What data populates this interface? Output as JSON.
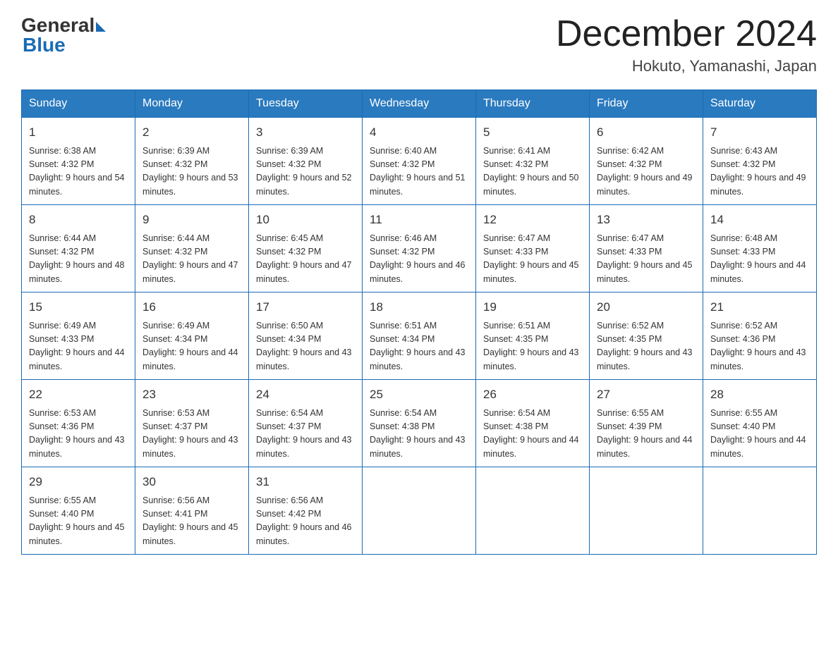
{
  "header": {
    "logo_general": "General",
    "logo_blue": "Blue",
    "month_title": "December 2024",
    "subtitle": "Hokuto, Yamanashi, Japan"
  },
  "weekdays": [
    "Sunday",
    "Monday",
    "Tuesday",
    "Wednesday",
    "Thursday",
    "Friday",
    "Saturday"
  ],
  "weeks": [
    [
      {
        "day": "1",
        "sunrise": "6:38 AM",
        "sunset": "4:32 PM",
        "daylight": "9 hours and 54 minutes."
      },
      {
        "day": "2",
        "sunrise": "6:39 AM",
        "sunset": "4:32 PM",
        "daylight": "9 hours and 53 minutes."
      },
      {
        "day": "3",
        "sunrise": "6:39 AM",
        "sunset": "4:32 PM",
        "daylight": "9 hours and 52 minutes."
      },
      {
        "day": "4",
        "sunrise": "6:40 AM",
        "sunset": "4:32 PM",
        "daylight": "9 hours and 51 minutes."
      },
      {
        "day": "5",
        "sunrise": "6:41 AM",
        "sunset": "4:32 PM",
        "daylight": "9 hours and 50 minutes."
      },
      {
        "day": "6",
        "sunrise": "6:42 AM",
        "sunset": "4:32 PM",
        "daylight": "9 hours and 49 minutes."
      },
      {
        "day": "7",
        "sunrise": "6:43 AM",
        "sunset": "4:32 PM",
        "daylight": "9 hours and 49 minutes."
      }
    ],
    [
      {
        "day": "8",
        "sunrise": "6:44 AM",
        "sunset": "4:32 PM",
        "daylight": "9 hours and 48 minutes."
      },
      {
        "day": "9",
        "sunrise": "6:44 AM",
        "sunset": "4:32 PM",
        "daylight": "9 hours and 47 minutes."
      },
      {
        "day": "10",
        "sunrise": "6:45 AM",
        "sunset": "4:32 PM",
        "daylight": "9 hours and 47 minutes."
      },
      {
        "day": "11",
        "sunrise": "6:46 AM",
        "sunset": "4:32 PM",
        "daylight": "9 hours and 46 minutes."
      },
      {
        "day": "12",
        "sunrise": "6:47 AM",
        "sunset": "4:33 PM",
        "daylight": "9 hours and 45 minutes."
      },
      {
        "day": "13",
        "sunrise": "6:47 AM",
        "sunset": "4:33 PM",
        "daylight": "9 hours and 45 minutes."
      },
      {
        "day": "14",
        "sunrise": "6:48 AM",
        "sunset": "4:33 PM",
        "daylight": "9 hours and 44 minutes."
      }
    ],
    [
      {
        "day": "15",
        "sunrise": "6:49 AM",
        "sunset": "4:33 PM",
        "daylight": "9 hours and 44 minutes."
      },
      {
        "day": "16",
        "sunrise": "6:49 AM",
        "sunset": "4:34 PM",
        "daylight": "9 hours and 44 minutes."
      },
      {
        "day": "17",
        "sunrise": "6:50 AM",
        "sunset": "4:34 PM",
        "daylight": "9 hours and 43 minutes."
      },
      {
        "day": "18",
        "sunrise": "6:51 AM",
        "sunset": "4:34 PM",
        "daylight": "9 hours and 43 minutes."
      },
      {
        "day": "19",
        "sunrise": "6:51 AM",
        "sunset": "4:35 PM",
        "daylight": "9 hours and 43 minutes."
      },
      {
        "day": "20",
        "sunrise": "6:52 AM",
        "sunset": "4:35 PM",
        "daylight": "9 hours and 43 minutes."
      },
      {
        "day": "21",
        "sunrise": "6:52 AM",
        "sunset": "4:36 PM",
        "daylight": "9 hours and 43 minutes."
      }
    ],
    [
      {
        "day": "22",
        "sunrise": "6:53 AM",
        "sunset": "4:36 PM",
        "daylight": "9 hours and 43 minutes."
      },
      {
        "day": "23",
        "sunrise": "6:53 AM",
        "sunset": "4:37 PM",
        "daylight": "9 hours and 43 minutes."
      },
      {
        "day": "24",
        "sunrise": "6:54 AM",
        "sunset": "4:37 PM",
        "daylight": "9 hours and 43 minutes."
      },
      {
        "day": "25",
        "sunrise": "6:54 AM",
        "sunset": "4:38 PM",
        "daylight": "9 hours and 43 minutes."
      },
      {
        "day": "26",
        "sunrise": "6:54 AM",
        "sunset": "4:38 PM",
        "daylight": "9 hours and 44 minutes."
      },
      {
        "day": "27",
        "sunrise": "6:55 AM",
        "sunset": "4:39 PM",
        "daylight": "9 hours and 44 minutes."
      },
      {
        "day": "28",
        "sunrise": "6:55 AM",
        "sunset": "4:40 PM",
        "daylight": "9 hours and 44 minutes."
      }
    ],
    [
      {
        "day": "29",
        "sunrise": "6:55 AM",
        "sunset": "4:40 PM",
        "daylight": "9 hours and 45 minutes."
      },
      {
        "day": "30",
        "sunrise": "6:56 AM",
        "sunset": "4:41 PM",
        "daylight": "9 hours and 45 minutes."
      },
      {
        "day": "31",
        "sunrise": "6:56 AM",
        "sunset": "4:42 PM",
        "daylight": "9 hours and 46 minutes."
      },
      null,
      null,
      null,
      null
    ]
  ],
  "labels": {
    "sunrise_prefix": "Sunrise: ",
    "sunset_prefix": "Sunset: ",
    "daylight_prefix": "Daylight: "
  }
}
